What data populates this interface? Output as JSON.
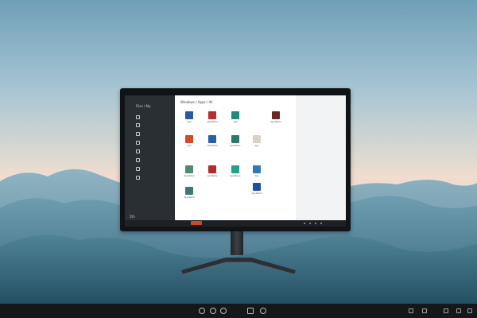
{
  "monitor_screen": {
    "sidebar": {
      "title": "Files / My",
      "items": [
        {
          "icon": "folder-icon"
        },
        {
          "icon": "document-icon"
        },
        {
          "icon": "image-icon"
        },
        {
          "icon": "music-icon"
        },
        {
          "icon": "video-icon"
        },
        {
          "icon": "download-icon"
        },
        {
          "icon": "settings-icon"
        },
        {
          "icon": "trash-icon"
        }
      ],
      "bottom_label": "5th"
    },
    "content": {
      "header": "Windows / Apps / All",
      "apps": [
        {
          "icon": "app-icon",
          "label": "App",
          "color": "#2b5a9c"
        },
        {
          "icon": "app-icon",
          "label": "App Name",
          "color": "#b2322b"
        },
        {
          "icon": "app-icon",
          "label": "App",
          "color": "#1f8a7a"
        },
        {
          "icon": "app-icon",
          "label": "App Name",
          "color": "#6a2a22"
        },
        {
          "icon": "app-icon",
          "label": "App",
          "color": "#d24a2a"
        },
        {
          "icon": "app-icon",
          "label": "App Name",
          "color": "#2a5fa8"
        },
        {
          "icon": "app-icon",
          "label": "App Name",
          "color": "#2d7a6a"
        },
        {
          "icon": "app-icon",
          "label": "App",
          "color": "#d8d3c8"
        },
        {
          "icon": "app-icon",
          "label": "App Name",
          "color": "#4f8a6a"
        },
        {
          "icon": "app-icon",
          "label": "App Name",
          "color": "#b52a2a"
        },
        {
          "icon": "app-icon",
          "label": "App Name",
          "color": "#25a08a"
        },
        {
          "icon": "app-icon",
          "label": "App",
          "color": "#2f79b5"
        },
        {
          "icon": "app-icon",
          "label": "App Name",
          "color": "#3a7a72"
        },
        {
          "icon": "app-icon",
          "label": "App Name",
          "color": "#1e4f9c"
        }
      ]
    }
  },
  "taskbar": {
    "center_icons": [
      "app-icon",
      "app-icon",
      "app-icon",
      "app-icon",
      "app-icon"
    ],
    "tray_icons": [
      "network-icon",
      "volume-icon",
      "battery-icon",
      "notification-icon"
    ]
  }
}
